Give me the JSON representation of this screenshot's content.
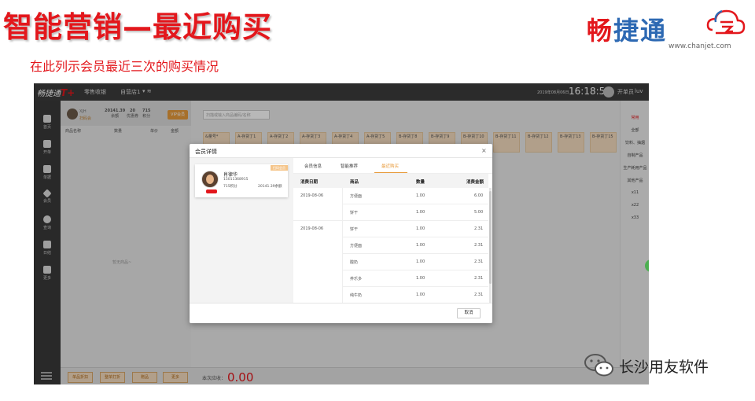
{
  "slide": {
    "title": "智能营销—最近购买",
    "subtitle": "在此列示会员最近三次的购买情况"
  },
  "brand": {
    "name_part1": "畅",
    "name_part2": "捷通",
    "url": "www.chanjet.com",
    "logo_icon": "chanjet-cloud-logo",
    "colors": {
      "blue": "#2d69b3",
      "red": "#e3171c"
    }
  },
  "watermark": {
    "text": "长沙用友软件",
    "icon": "wechat-icon"
  },
  "app": {
    "topbar": {
      "logo": "畅捷通",
      "logo_suffix": "T+",
      "module": "零售收银",
      "store": "自营店1",
      "date": "2019年08月06日",
      "time": "16:18:52",
      "role": "开单员",
      "user": "luv"
    },
    "left_nav": [
      {
        "label": "首页",
        "icon": "home-icon"
      },
      {
        "label": "开单",
        "icon": "document-icon"
      },
      {
        "label": "单据",
        "icon": "list-icon"
      },
      {
        "label": "会员",
        "icon": "diamond-icon"
      },
      {
        "label": "查询",
        "icon": "search-icon"
      },
      {
        "label": "日结",
        "icon": "report-icon"
      },
      {
        "label": "更多",
        "icon": "grid-icon"
      }
    ],
    "cart": {
      "member_name": "XJH",
      "member_tag": "扫码会",
      "stats": [
        {
          "value": "20141.39",
          "label": "余额"
        },
        {
          "value": "20",
          "label": "优惠券"
        },
        {
          "value": "715",
          "label": "积分"
        }
      ],
      "vip_button": "VIP会员",
      "columns": [
        "商品名称",
        "数量",
        "单价",
        "金额"
      ],
      "empty_text": "暂无商品~"
    },
    "main": {
      "search_placeholder": "扫描或输入商品编码/名称",
      "tiles": [
        "&量号*",
        "A-存货丁1",
        "A-存货丁2",
        "A-存货丁3",
        "A-存货丁4",
        "A-存货丁5",
        "B-存货丁8",
        "B-存货丁9",
        "B-存货丁10",
        "B-存货丁11",
        "B-存货丁12",
        "B-存货丁13",
        "B-存货丁15"
      ]
    },
    "right_categories": [
      "常用",
      "全部",
      "饮料、抽烟",
      "自制产品",
      "生产耗用产品",
      "其他产品",
      "x11",
      "x22",
      "x33"
    ],
    "bottom": {
      "buttons": [
        "单品折扣",
        "整单打折",
        "赠品",
        "更多"
      ],
      "total_label": "本次应收：",
      "total_value": "0.00"
    }
  },
  "modal": {
    "title": "会员详情",
    "close": "×",
    "member": {
      "name": "肖律华",
      "phone": "15011368915",
      "points": "715积分",
      "balance": "20141.39余额",
      "tag": "扫码会员"
    },
    "tabs": [
      "会员信息",
      "智能推荐",
      "最近购买"
    ],
    "active_tab": "最近购买",
    "table": {
      "headers": [
        "消费日期",
        "商品",
        "数量",
        "消费金额"
      ],
      "groups": [
        {
          "date": "2019-08-06",
          "rows": [
            {
              "product": "方便面",
              "qty": "1.00",
              "amount": "6.00"
            },
            {
              "product": "饼干",
              "qty": "1.00",
              "amount": "5.00"
            }
          ]
        },
        {
          "date": "2019-08-06",
          "rows": [
            {
              "product": "饼干",
              "qty": "1.00",
              "amount": "2.31"
            },
            {
              "product": "方便面",
              "qty": "1.00",
              "amount": "2.31"
            },
            {
              "product": "酸奶",
              "qty": "1.00",
              "amount": "2.31"
            },
            {
              "product": "养乐多",
              "qty": "1.00",
              "amount": "2.31"
            },
            {
              "product": "纯牛奶",
              "qty": "1.00",
              "amount": "2.31"
            }
          ]
        }
      ]
    },
    "cancel": "取消"
  }
}
